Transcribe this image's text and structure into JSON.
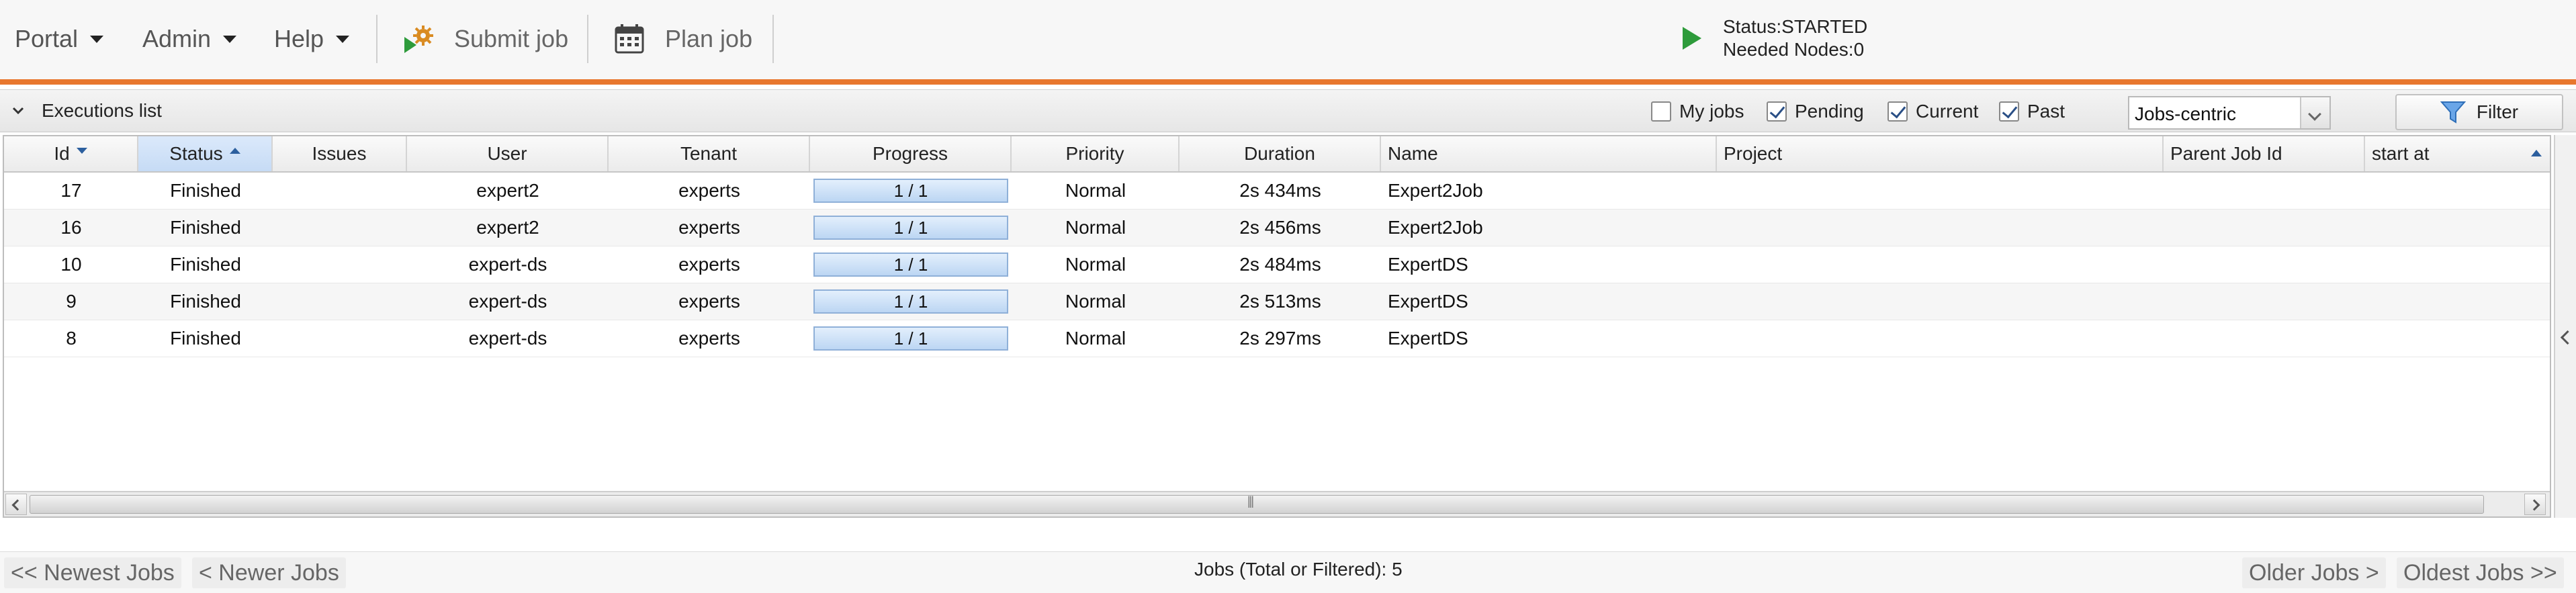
{
  "topbar": {
    "menus": [
      {
        "label": "Portal"
      },
      {
        "label": "Admin"
      },
      {
        "label": "Help"
      }
    ],
    "tools": {
      "submit_job": "Submit job",
      "plan_job": "Plan job"
    },
    "status": {
      "line1": "Status:STARTED",
      "line2": "Needed Nodes:0",
      "icon": "play-icon",
      "color": "#2e9b3b"
    },
    "accent_color": "#e8772e"
  },
  "panel": {
    "title": "Executions list",
    "checkboxes": [
      {
        "label": "My jobs",
        "checked": false
      },
      {
        "label": "Pending",
        "checked": true
      },
      {
        "label": "Current",
        "checked": true
      },
      {
        "label": "Past",
        "checked": true
      }
    ],
    "view_select": {
      "value": "Jobs-centric"
    },
    "filter_label": "Filter"
  },
  "grid": {
    "columns": [
      {
        "key": "id",
        "label": "Id",
        "sort": "desc"
      },
      {
        "key": "status",
        "label": "Status",
        "sort": "asc"
      },
      {
        "key": "issues",
        "label": "Issues"
      },
      {
        "key": "user",
        "label": "User"
      },
      {
        "key": "tenant",
        "label": "Tenant"
      },
      {
        "key": "progress",
        "label": "Progress"
      },
      {
        "key": "priority",
        "label": "Priority"
      },
      {
        "key": "duration",
        "label": "Duration"
      },
      {
        "key": "name",
        "label": "Name"
      },
      {
        "key": "project",
        "label": "Project"
      },
      {
        "key": "parent_job_id",
        "label": "Parent Job Id"
      },
      {
        "key": "start_at",
        "label": "start at"
      }
    ],
    "rows": [
      {
        "id": "17",
        "status": "Finished",
        "issues": "",
        "user": "expert2",
        "tenant": "experts",
        "progress": "1 / 1",
        "progress_fraction": 1.0,
        "priority": "Normal",
        "duration": "2s 434ms",
        "name": "Expert2Job",
        "project": "",
        "parent_job_id": "",
        "start_at": ""
      },
      {
        "id": "16",
        "status": "Finished",
        "issues": "",
        "user": "expert2",
        "tenant": "experts",
        "progress": "1 / 1",
        "progress_fraction": 1.0,
        "priority": "Normal",
        "duration": "2s 456ms",
        "name": "Expert2Job",
        "project": "",
        "parent_job_id": "",
        "start_at": ""
      },
      {
        "id": "10",
        "status": "Finished",
        "issues": "",
        "user": "expert-ds",
        "tenant": "experts",
        "progress": "1 / 1",
        "progress_fraction": 1.0,
        "priority": "Normal",
        "duration": "2s 484ms",
        "name": "ExpertDS",
        "project": "",
        "parent_job_id": "",
        "start_at": ""
      },
      {
        "id": "9",
        "status": "Finished",
        "issues": "",
        "user": "expert-ds",
        "tenant": "experts",
        "progress": "1 / 1",
        "progress_fraction": 1.0,
        "priority": "Normal",
        "duration": "2s 513ms",
        "name": "ExpertDS",
        "project": "",
        "parent_job_id": "",
        "start_at": ""
      },
      {
        "id": "8",
        "status": "Finished",
        "issues": "",
        "user": "expert-ds",
        "tenant": "experts",
        "progress": "1 / 1",
        "progress_fraction": 1.0,
        "priority": "Normal",
        "duration": "2s 297ms",
        "name": "ExpertDS",
        "project": "",
        "parent_job_id": "",
        "start_at": ""
      }
    ]
  },
  "footer": {
    "newest": "<< Newest Jobs",
    "newer": "< Newer Jobs",
    "count": "Jobs (Total or Filtered): 5",
    "older": "Older Jobs >",
    "oldest": "Oldest Jobs >>"
  }
}
